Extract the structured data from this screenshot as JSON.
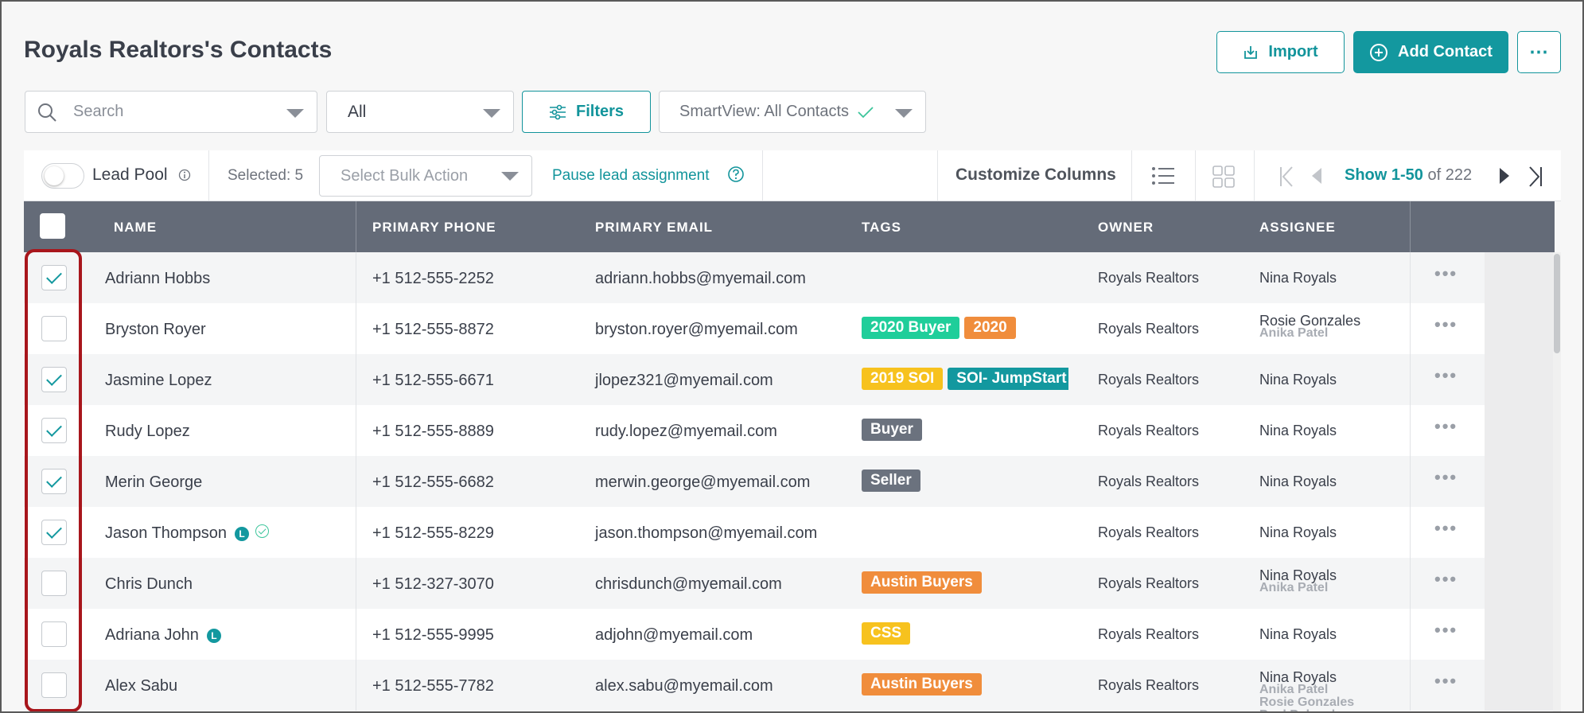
{
  "page": {
    "title": "Royals Realtors's Contacts"
  },
  "header_actions": {
    "import_label": "Import",
    "add_contact_label": "Add Contact",
    "more_label": "⋯"
  },
  "toolbar": {
    "search_placeholder": "Search",
    "scope_value": "All",
    "filters_label": "Filters",
    "smartview_label": "SmartView: All Contacts"
  },
  "subbar": {
    "lead_pool_label": "Lead Pool",
    "selected_label": "Selected: 5",
    "bulk_action_placeholder": "Select Bulk Action",
    "pause_label": "Pause lead assignment",
    "customize_label": "Customize Columns",
    "pagination": {
      "show_label": "Show 1-50",
      "of_label": "of 222"
    }
  },
  "table": {
    "columns": [
      "NAME",
      "PRIMARY PHONE",
      "PRIMARY EMAIL",
      "TAGS",
      "OWNER",
      "ASSIGNEE"
    ],
    "rows": [
      {
        "name": "Adriann Hobbs",
        "phone": "+1 512-555-2252",
        "email": "adriann.hobbs@myemail.com",
        "owner": "Royals Realtors",
        "assignee": "Nina Royals",
        "assignee_sub": []
      },
      {
        "name": "Bryston Royer",
        "phone": "+1 512-555-8872",
        "email": "bryston.royer@myemail.com",
        "owner": "Royals Realtors",
        "assignee": "Rosie Gonzales",
        "assignee_sub": [
          "Anika Patel"
        ]
      },
      {
        "name": "Jasmine Lopez",
        "phone": "+1 512-555-6671",
        "email": "jlopez321@myemail.com",
        "owner": "Royals Realtors",
        "assignee": "Nina Royals",
        "assignee_sub": []
      },
      {
        "name": "Rudy Lopez",
        "phone": "+1 512-555-8889",
        "email": "rudy.lopez@myemail.com",
        "owner": "Royals Realtors",
        "assignee": "Nina Royals",
        "assignee_sub": []
      },
      {
        "name": "Merin George",
        "phone": "+1 512-555-6682",
        "email": "merwin.george@myemail.com",
        "owner": "Royals Realtors",
        "assignee": "Nina Royals",
        "assignee_sub": []
      },
      {
        "name": "Jason Thompson",
        "phone": "+1 512-555-8229",
        "email": "jason.thompson@myemail.com",
        "owner": "Royals Realtors",
        "assignee": "Nina Royals",
        "assignee_sub": []
      },
      {
        "name": "Chris Dunch",
        "phone": "+1 512-327-3070",
        "email": "chrisdunch@myemail.com",
        "owner": "Royals Realtors",
        "assignee": "Nina Royals",
        "assignee_sub": [
          "Anika Patel"
        ]
      },
      {
        "name": "Adriana John",
        "phone": "+1 512-555-9995",
        "email": "adjohn@myemail.com",
        "owner": "Royals Realtors",
        "assignee": "Nina Royals",
        "assignee_sub": []
      },
      {
        "name": "Alex Sabu",
        "phone": "+1 512-555-7782",
        "email": "alex.sabu@myemail.com",
        "owner": "Royals Realtors",
        "assignee": "Nina Royals",
        "assignee_sub": [
          "Anika Patel",
          "Rosie Gonzales",
          "Paul Polansky"
        ]
      }
    ],
    "row_checked": [
      true,
      false,
      true,
      true,
      true,
      true,
      false,
      false,
      false
    ],
    "row_tags": [
      [],
      [
        {
          "label": "2020 Buyer",
          "color": "#1fce9a"
        },
        {
          "label": "2020",
          "color": "#f08d3c"
        }
      ],
      [
        {
          "label": "2019 SOI",
          "color": "#f7c21e"
        },
        {
          "label": "SOI- JumpStart",
          "color": "#13989f"
        }
      ],
      [
        {
          "label": "Buyer",
          "color": "#6b727e"
        }
      ],
      [
        {
          "label": "Seller",
          "color": "#6b727e"
        }
      ],
      [],
      [
        {
          "label": "Austin Buyers",
          "color": "#f08d3c"
        }
      ],
      [
        {
          "label": "CSS",
          "color": "#f7c21e"
        }
      ],
      [
        {
          "label": "Austin Buyers",
          "color": "#f08d3c"
        }
      ]
    ],
    "row_badges": [
      [],
      [],
      [],
      [],
      [],
      [
        "L",
        "verified"
      ],
      [],
      [
        "L"
      ],
      []
    ]
  },
  "colors": {
    "accent": "#13989f",
    "header_bg": "#646b78",
    "highlight": "#a8161c"
  }
}
